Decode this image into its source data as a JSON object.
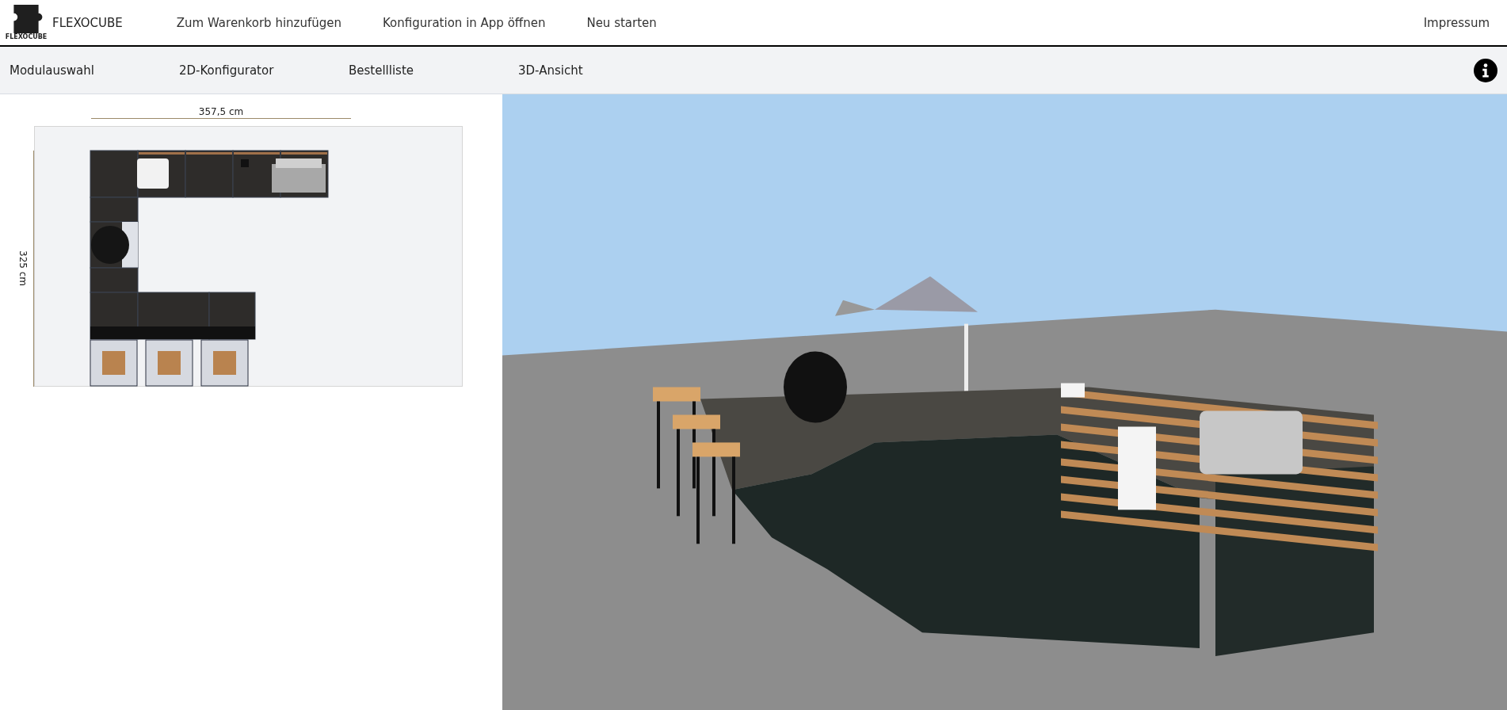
{
  "header": {
    "logo_text": "FLEXOCUBE",
    "brand": "FLEXOCUBE",
    "links": [
      "Zum Warenkorb hinzufügen",
      "Konfiguration in App öffnen",
      "Neu starten"
    ],
    "right_link": "Impressum"
  },
  "tabs": [
    {
      "label": "Modulauswahl"
    },
    {
      "label": "2D-Konfigurator"
    },
    {
      "label": "Bestellliste"
    },
    {
      "label": "3D-Ansicht"
    }
  ],
  "plan": {
    "width_label": "357,5 cm",
    "height_label": "325 cm"
  }
}
